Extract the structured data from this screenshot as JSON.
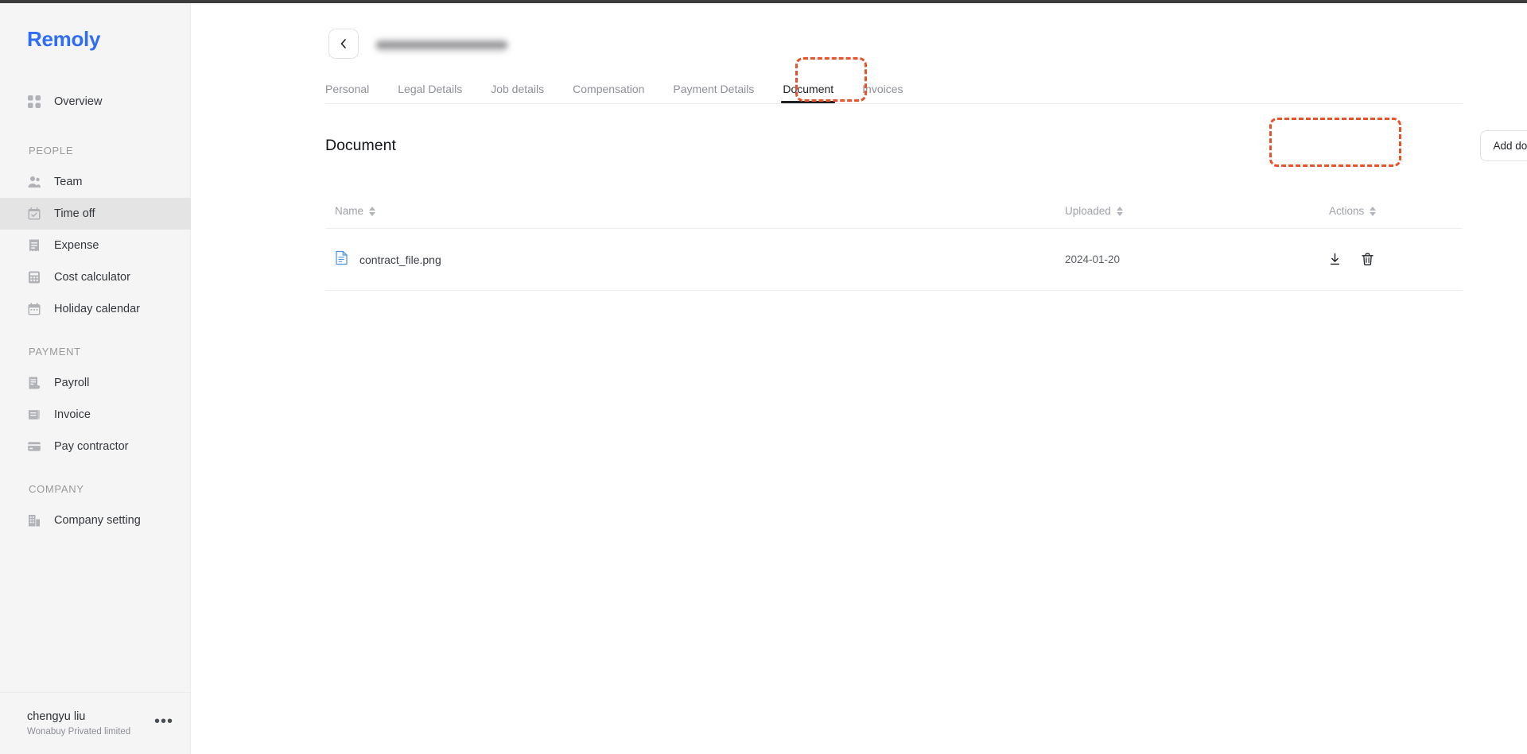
{
  "brand": {
    "name": "Remoly",
    "color": "#2f6df6"
  },
  "sidebar": {
    "overview": {
      "label": "Overview",
      "icon": "grid-icon"
    },
    "sections": [
      {
        "label": "PEOPLE",
        "items": [
          {
            "label": "Team",
            "icon": "people-icon",
            "active": false
          },
          {
            "label": "Time off",
            "icon": "calendar-check-icon",
            "active": true
          },
          {
            "label": "Expense",
            "icon": "receipt-icon",
            "active": false
          },
          {
            "label": "Cost calculator",
            "icon": "calculator-icon",
            "active": false
          },
          {
            "label": "Holiday calendar",
            "icon": "calendar-icon",
            "active": false
          }
        ]
      },
      {
        "label": "PAYMENT",
        "items": [
          {
            "label": "Payroll",
            "icon": "payroll-icon",
            "active": false
          },
          {
            "label": "Invoice",
            "icon": "invoice-icon",
            "active": false
          },
          {
            "label": "Pay contractor",
            "icon": "card-icon",
            "active": false
          }
        ]
      },
      {
        "label": "COMPANY",
        "items": [
          {
            "label": "Company setting",
            "icon": "building-icon",
            "active": false
          }
        ]
      }
    ],
    "footer": {
      "user_name": "chengyu liu",
      "organization": "Wonabuy Privated limited",
      "menu_icon": "ellipsis-icon"
    }
  },
  "header": {
    "back_icon": "chevron-left-icon",
    "employee_name_redacted": ""
  },
  "tabs": [
    {
      "label": "Personal",
      "active": false
    },
    {
      "label": "Legal Details",
      "active": false
    },
    {
      "label": "Job details",
      "active": false
    },
    {
      "label": "Compensation",
      "active": false
    },
    {
      "label": "Payment Details",
      "active": false
    },
    {
      "label": "Document",
      "active": true
    },
    {
      "label": "Invoices",
      "active": false
    }
  ],
  "main": {
    "section_title": "Document",
    "add_document_label": "Add document"
  },
  "table": {
    "columns": [
      {
        "label": "Name",
        "sortable": true
      },
      {
        "label": "Uploaded",
        "sortable": true
      },
      {
        "label": "Actions",
        "sortable": true
      }
    ],
    "rows": [
      {
        "file_icon": "file-document-icon",
        "name": "contract_file.png",
        "uploaded": "2024-01-20",
        "actions": [
          {
            "icon": "download-icon",
            "label": "Download"
          },
          {
            "icon": "trash-icon",
            "label": "Delete"
          }
        ]
      }
    ]
  },
  "annotations": {
    "color": "#e8522a",
    "targets": [
      "Document tab",
      "Add document button"
    ]
  }
}
